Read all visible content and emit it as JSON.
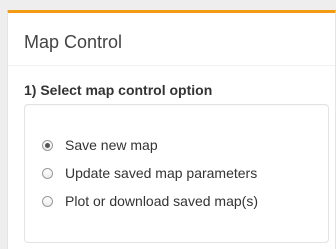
{
  "panel": {
    "title": "Map Control",
    "accent_color": "#f39c12",
    "section_label": "1) Select map control option"
  },
  "options": [
    {
      "label": "Save new map",
      "selected": true,
      "icon": "radio-checked"
    },
    {
      "label": "Update saved map parameters",
      "selected": false,
      "icon": "radio-unchecked"
    },
    {
      "label": "Plot or download saved map(s)",
      "selected": false,
      "icon": "radio-unchecked"
    }
  ]
}
